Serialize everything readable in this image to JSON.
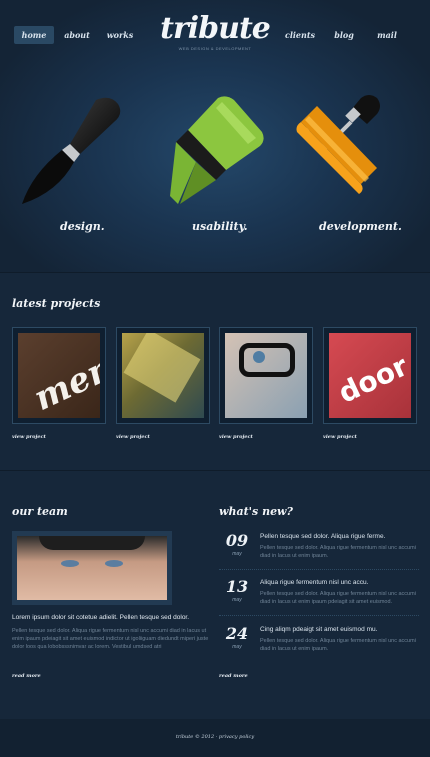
{
  "nav": {
    "items": [
      "home",
      "about",
      "works",
      "clients",
      "blog",
      "mail"
    ],
    "active": "home"
  },
  "logo": {
    "text": "tribute",
    "tagline": "WEB DESIGN & DEVELOPMENT"
  },
  "hero": {
    "labels": [
      "design.",
      "usability.",
      "development."
    ]
  },
  "projects": {
    "title": "latest projects",
    "link_label": "view project",
    "items": [
      {
        "thumb_text": "mem",
        "color": "#4a3426"
      },
      {
        "thumb_text": "",
        "color": "#6d6a33"
      },
      {
        "thumb_text": "",
        "color": "#33475a"
      },
      {
        "thumb_text": "door",
        "color": "#c24148"
      }
    ]
  },
  "team": {
    "title": "our team",
    "lead": "Lorem ipsum dolor sit cotetue adielit. Pellen tesque sed dolor.",
    "body": "Pellen tesque sed dolor. Aliqua rigue fermentum nisl unc accumi diad in lacus ut enim ipaum pdeiagit sit amet euismod indictor ut igoliiguam diedundt miperi juste dolor loos qua lobobsssnimvar ac lorem. Vestibul umdsed atri",
    "read_more": "read more"
  },
  "news": {
    "title": "what's new?",
    "items": [
      {
        "day": "09",
        "month": "may",
        "title": "Pellen tesque sed dolor. Aliqua rigue ferme.",
        "body": "Pellen tesque sed dolor. Aliqua rigue fermentum nisl unc accumi diad in lacus ut enim ipaum."
      },
      {
        "day": "13",
        "month": "may",
        "title": "Aliqua rigue fermentum nisl unc accu.",
        "body": "Pellen tesque sed dolor. Aliqua rigue fermentum nisl unc accumi diad in lacus ut enim ipaum pdeiagit sit amet euismod."
      },
      {
        "day": "24",
        "month": "may",
        "title": "Cing aliqm pdeaigt sit amet euismod mu.",
        "body": "Pellen tesque sed dolor. Aliqua rigue fermentum nisl unc accumi diad in lacus ut enim ipaum."
      }
    ],
    "read_more": "read more"
  },
  "footer": {
    "text": "tribute © 2012 · privacy policy"
  },
  "colors": {
    "background": "#16273a",
    "hero_glow": "#24486a",
    "accent_green": "#8cc63f",
    "accent_orange": "#f7a21b"
  }
}
